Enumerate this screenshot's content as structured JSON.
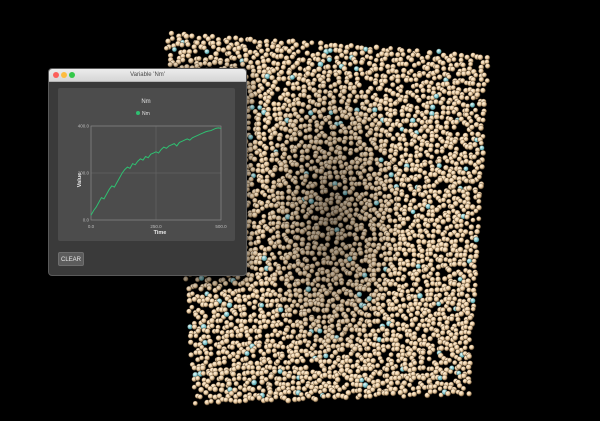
{
  "window": {
    "title": "Variable 'Nm'",
    "clear_label": "CLEAR"
  },
  "colors": {
    "background": "#000000",
    "particle": "#e8c9a0",
    "particle_shadow": "#6b5537",
    "highlight_particle": "#7fe0e8",
    "series": "#2fbf71",
    "plot_bg": "#4c4c4c"
  },
  "chart_data": {
    "type": "line",
    "title": "Nm",
    "xlabel": "Time",
    "ylabel": "Value",
    "xlim": [
      0,
      500
    ],
    "ylim": [
      0,
      400
    ],
    "x_ticks": [
      "0.0",
      "250.0",
      "500.0"
    ],
    "y_ticks": [
      "0.0",
      "200.0",
      "400.0"
    ],
    "grid": true,
    "legend": "top",
    "series": [
      {
        "name": "Nm",
        "x": [
          0,
          10,
          20,
          30,
          40,
          50,
          60,
          70,
          80,
          90,
          100,
          110,
          120,
          130,
          140,
          150,
          160,
          170,
          180,
          190,
          200,
          210,
          220,
          230,
          240,
          250,
          260,
          270,
          280,
          290,
          300,
          310,
          320,
          330,
          340,
          350,
          360,
          370,
          380,
          390,
          400,
          410,
          420,
          430,
          440,
          450,
          460,
          470,
          480,
          490,
          500
        ],
        "values": [
          20,
          40,
          55,
          75,
          95,
          90,
          110,
          130,
          145,
          140,
          160,
          180,
          200,
          215,
          225,
          220,
          240,
          235,
          250,
          260,
          255,
          270,
          265,
          280,
          285,
          290,
          285,
          300,
          310,
          305,
          315,
          320,
          325,
          315,
          330,
          335,
          340,
          345,
          340,
          350,
          355,
          360,
          365,
          370,
          375,
          378,
          380,
          385,
          390,
          392,
          390
        ]
      }
    ]
  }
}
